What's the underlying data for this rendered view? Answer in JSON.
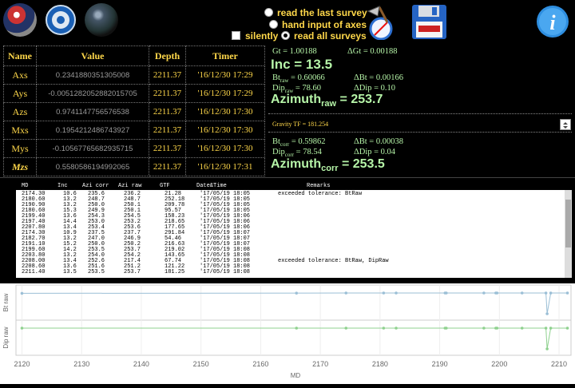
{
  "toolbar": {
    "radio_last": "read the last survey",
    "radio_hand": "hand input of axes",
    "check_silently": "silently",
    "radio_all": "read all surveys",
    "selected": "read all surveys"
  },
  "table": {
    "headers": [
      "Name",
      "Value",
      "Depth",
      "Timer"
    ],
    "rows": [
      {
        "name": "Axs",
        "value": "0.2341880351305008",
        "depth": "2211.37",
        "timer": "'16/12/30 17:29"
      },
      {
        "name": "Ays",
        "value": "-0.0051282052882015705",
        "depth": "2211.37",
        "timer": "'16/12/30 17:29"
      },
      {
        "name": "Azs",
        "value": "0.9741147756576538",
        "depth": "2211.37",
        "timer": "'16/12/30 17:30"
      },
      {
        "name": "Mxs",
        "value": "0.1954212486743927",
        "depth": "2211.37",
        "timer": "'16/12/30 17:30"
      },
      {
        "name": "Mys",
        "value": "-0.10567765682935715",
        "depth": "2211.37",
        "timer": "'16/12/30 17:30"
      },
      {
        "name": "Mzs",
        "value": "0.5580586194992065",
        "depth": "2211.37",
        "timer": "'16/12/30 17:31"
      }
    ]
  },
  "panel": {
    "gt": "Gt = 1.00188",
    "dgt": "ΔGt = 0.00188",
    "inc": "Inc = 13.5",
    "bt_raw": "= 0.60066",
    "dbt_raw": "ΔBt = 0.00166",
    "dip_raw": "= 78.60",
    "ddip_raw": "ΔDip = 0.10",
    "azi_raw": "= 253.7",
    "gravity_tf": "Gravity TF = 181.254",
    "bt_corr": "= 0.59862",
    "dbt_corr": "ΔBt = 0.00038",
    "dip_corr": "= 78.54",
    "ddip_corr": "ΔDip = 0.04",
    "azi_corr": "= 253.5",
    "lbl_bt": "Bt",
    "lbl_dip": "Dip",
    "lbl_azimuth": "Azimuth",
    "sub_raw": "raw",
    "sub_corr": "corr"
  },
  "log": {
    "headers": [
      "MD",
      "Inc",
      "Azi corr",
      "Azi raw",
      "GTF",
      "Date&Time",
      "Remarks"
    ],
    "rows": [
      [
        "2174.30",
        "10.6",
        "235.6",
        "236.2",
        "21.28",
        "'17/05/19 18:05",
        "exceeded tolerance: BtRaw"
      ],
      [
        "2180.60",
        "13.2",
        "248.7",
        "248.7",
        "252.18",
        "'17/05/19 18:05",
        ""
      ],
      [
        "2190.90",
        "13.2",
        "250.0",
        "250.1",
        "209.78",
        "'17/05/19 18:05",
        ""
      ],
      [
        "2180.60",
        "15.3",
        "249.9",
        "250.1",
        "95.57",
        "'17/05/19 18:05",
        ""
      ],
      [
        "2199.40",
        "13.6",
        "254.3",
        "254.5",
        "158.23",
        "'17/05/19 18:06",
        ""
      ],
      [
        "2197.40",
        "14.4",
        "253.0",
        "253.2",
        "218.65",
        "'17/05/19 18:06",
        ""
      ],
      [
        "2207.80",
        "13.4",
        "253.4",
        "253.6",
        "177.65",
        "'17/05/19 18:06",
        ""
      ],
      [
        "2174.30",
        "10.9",
        "237.5",
        "237.7",
        "291.84",
        "'17/05/19 18:07",
        ""
      ],
      [
        "2182.70",
        "13.2",
        "247.0",
        "246.9",
        "54.46",
        "'17/05/19 18:07",
        ""
      ],
      [
        "2191.10",
        "15.2",
        "250.0",
        "250.2",
        "216.63",
        "'17/05/19 18:07",
        ""
      ],
      [
        "2199.60",
        "14.2",
        "253.5",
        "253.7",
        "219.02",
        "'17/05/19 18:08",
        ""
      ],
      [
        "2203.80",
        "13.2",
        "254.0",
        "254.2",
        "143.65",
        "'17/05/19 18:08",
        ""
      ],
      [
        "2208.00",
        "13.4",
        "252.6",
        "217.4",
        "67.74",
        "'17/05/19 18:08",
        "exceeded tolerance: BtRaw, DipRaw"
      ],
      [
        "2208.60",
        "13.6",
        "251.6",
        "251.2",
        "121.22",
        "'17/05/19 18:08",
        ""
      ],
      [
        "2211.40",
        "13.5",
        "253.5",
        "253.7",
        "181.25",
        "'17/05/19 18:08",
        ""
      ]
    ]
  },
  "chart_data": {
    "type": "line",
    "xlabel": "MD",
    "x_ticks": [
      "2120",
      "2130",
      "2140",
      "2150",
      "2160",
      "2170",
      "2180",
      "2190",
      "2200",
      "2210"
    ],
    "xlim": [
      2119,
      2212
    ],
    "series": [
      {
        "name": "Bt raw",
        "color": "#9bbfd6",
        "x": [
          2120,
          2166,
          2174.3,
          2180.6,
          2182.7,
          2190.9,
          2191.1,
          2197.4,
          2199.4,
          2199.6,
          2203.8,
          2207.8,
          2208.0,
          2208.6,
          2211.4
        ],
        "y": [
          0.6,
          0.601,
          0.6015,
          0.6015,
          0.6015,
          0.6015,
          0.6015,
          0.6015,
          0.6015,
          0.6015,
          0.6015,
          0.6015,
          0.5,
          0.6015,
          0.6015
        ]
      },
      {
        "name": "Dip raw",
        "color": "#8fd18f",
        "x": [
          2120,
          2166,
          2174.3,
          2180.6,
          2182.7,
          2190.9,
          2191.1,
          2197.4,
          2199.4,
          2199.6,
          2203.8,
          2207.8,
          2208.0,
          2208.6,
          2211.4
        ],
        "y": [
          78.6,
          78.6,
          78.6,
          78.6,
          78.6,
          78.6,
          78.6,
          78.6,
          78.6,
          78.6,
          78.6,
          78.6,
          78.0,
          78.6,
          78.6
        ]
      }
    ],
    "y_labels": [
      "Bt raw",
      "Dip raw"
    ]
  }
}
